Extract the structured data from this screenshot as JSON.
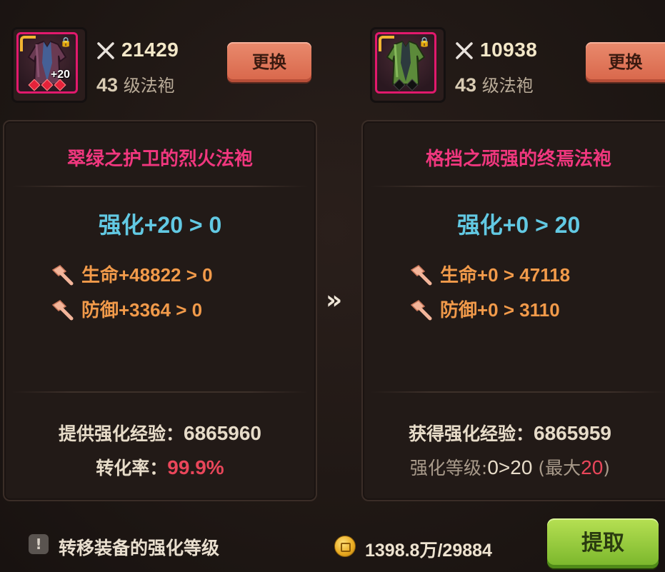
{
  "left_item": {
    "power": "21429",
    "level": "43",
    "type_label": "级法袍",
    "plus": "+20",
    "swap_label": "更换",
    "name": "翠绿之护卫的烈火法袍",
    "enhance": "强化+20 > 0",
    "stats": [
      {
        "text": "生命+48822 > 0"
      },
      {
        "text": "防御+3364 > 0"
      }
    ],
    "exp_label": "提供强化经验：",
    "exp_value": "6865960",
    "rate_label": "转化率：",
    "rate_value": "99.9%",
    "robe_color": "#6a3a52"
  },
  "right_item": {
    "power": "10938",
    "level": "43",
    "type_label": "级法袍",
    "swap_label": "更换",
    "name": "格挡之顽强的终焉法袍",
    "enhance": "强化+0 > 20",
    "stats": [
      {
        "text": "生命+0 > 47118"
      },
      {
        "text": "防御+0 > 3110"
      }
    ],
    "exp_label": "获得强化经验：",
    "exp_value": "6865959",
    "lvl_label": "强化等级:",
    "lvl_change": "0>20",
    "lvl_max_open": " (最大",
    "lvl_max": "20",
    "lvl_max_close": ")",
    "robe_color": "#5c8a3a"
  },
  "arrow": "»",
  "bottom": {
    "transfer_label": "转移装备的强化等级",
    "warn_glyph": "!",
    "money": "1398.8万/29884",
    "extract_label": "提取"
  },
  "colors": {
    "title_pink": "#f0377e",
    "enhance_cyan": "#62c9e3",
    "stat_orange": "#f19a4a",
    "swap_btn": "#e07a5c",
    "extract_btn": "#9acc3c",
    "slot_border": "#e2196d"
  }
}
